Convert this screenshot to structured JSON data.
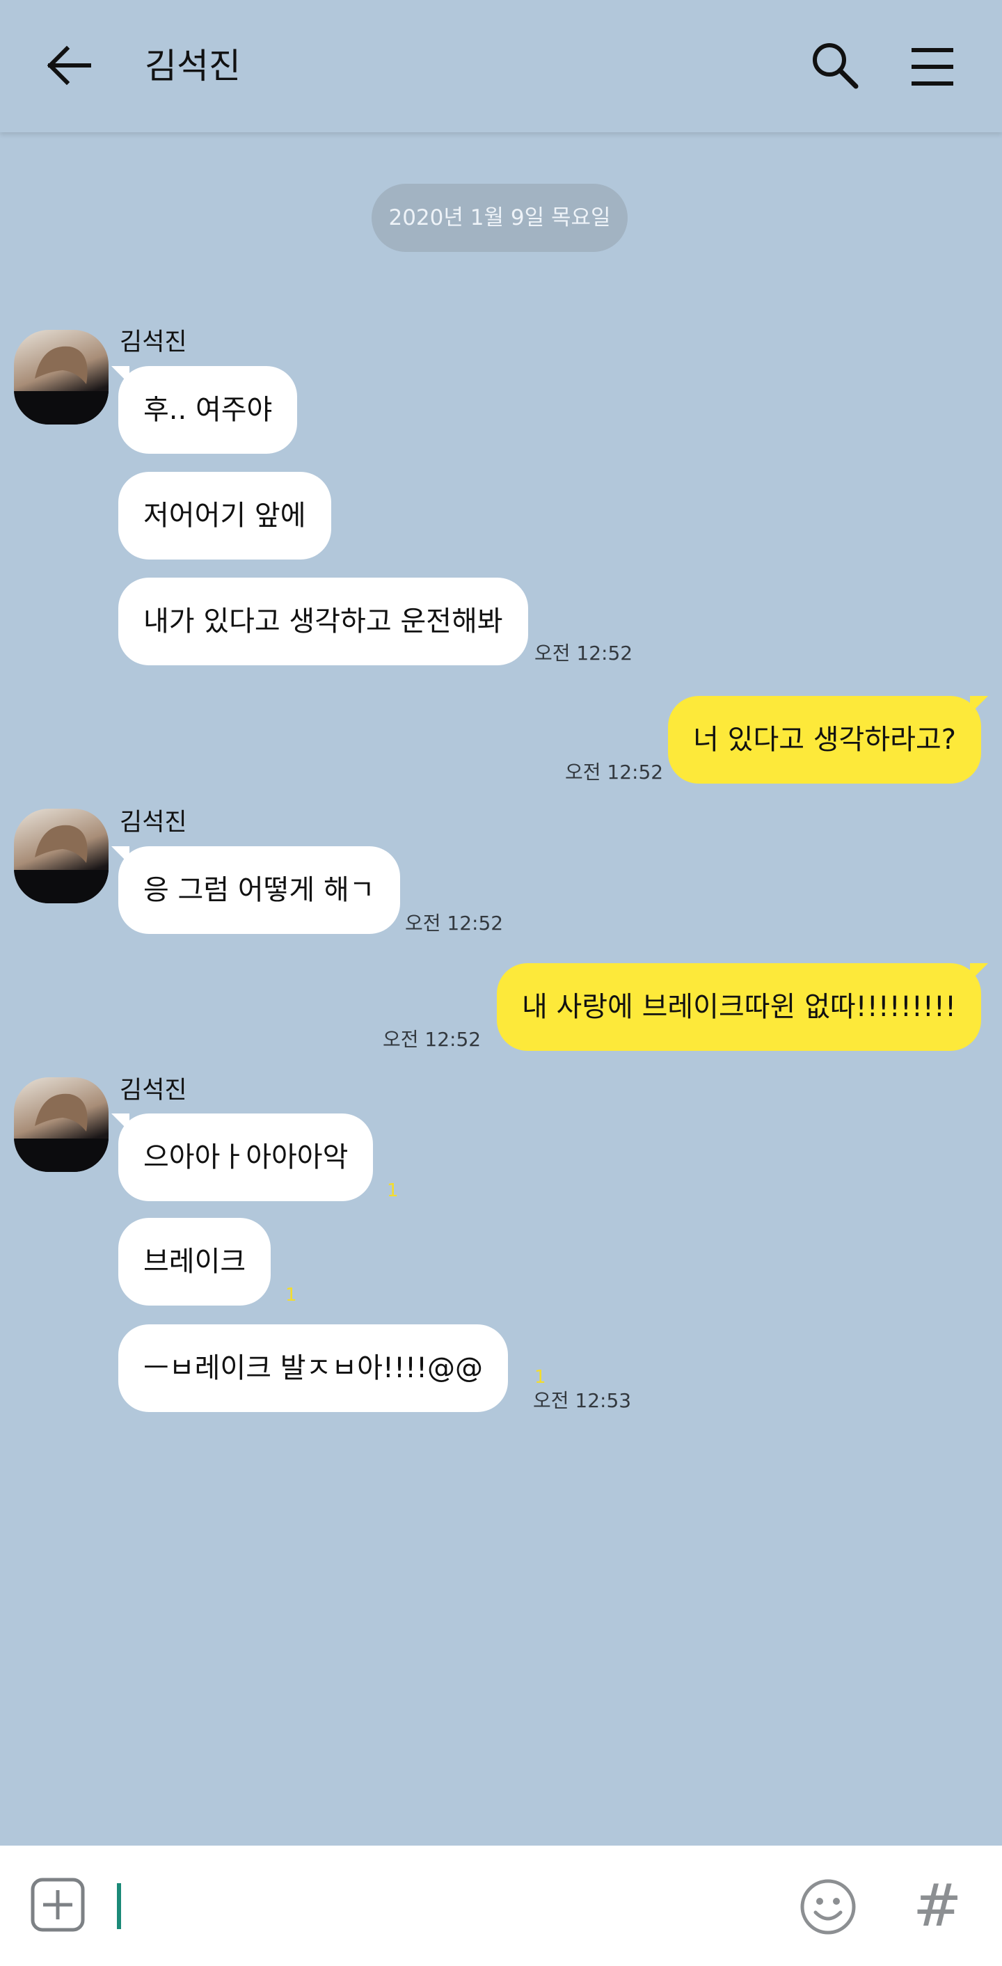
{
  "header": {
    "title": "김석진",
    "back_icon": "arrow-left-icon",
    "search_icon": "search-icon",
    "menu_icon": "hamburger-menu-icon"
  },
  "date_divider": "2020년 1월 9일 목요일",
  "messages": [
    {
      "sender": "김석진",
      "bubbles": [
        "후.. 여주야",
        "저어어기 앞에",
        "내가 있다고 생각하고 운전해봐"
      ],
      "time": "오전 12:52"
    },
    {
      "mine": true,
      "bubbles": [
        "너 있다고 생각하라고?"
      ],
      "time": "오전 12:52"
    },
    {
      "sender": "김석진",
      "bubbles": [
        "응 그럼 어떻게 해ㄱ"
      ],
      "time": "오전 12:52"
    },
    {
      "mine": true,
      "bubbles": [
        "내 사랑에 브레이크따윈 없따!!!!!!!!!"
      ],
      "time": "오전 12:52"
    },
    {
      "sender": "김석진",
      "bubbles": [
        "으아아ㅏ아아아악",
        "브레이크",
        "ㅡㅂ레이크 발ㅈㅂ아!!!!@@"
      ],
      "unread": [
        "1",
        "1",
        "1"
      ],
      "time": "오전 12:53"
    }
  ],
  "input_bar": {
    "attach_icon": "plus-box-icon",
    "emoji_icon": "smiley-icon",
    "hashtag_label": "#"
  },
  "colors": {
    "background": "#b2c7da",
    "my_bubble": "#fde93a",
    "their_bubble": "#ffffff",
    "unread_count": "#f4dd2b",
    "caret": "#1b8a78"
  }
}
